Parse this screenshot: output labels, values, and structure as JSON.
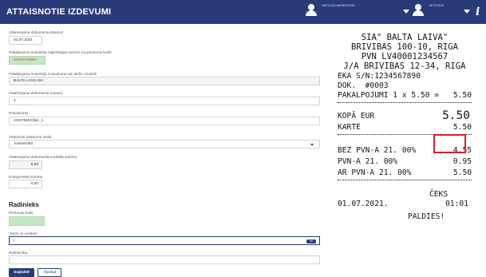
{
  "header": {
    "title": "ATTAISNOTIE IZDEVUMI",
    "user1": "NIKOLAJS NAKRASTIŅŠ",
    "user2": "LIETOTĀJS",
    "info_glyph": "i"
  },
  "form": {
    "doc_date_label": "Attaisnojuma dokumenta datums*",
    "doc_date_value": "01.07.2021",
    "seller_reg_label": "Pakalpojuma sniedzēja reģistrācijas numurs vai personas kods*",
    "seller_reg_value": "40001234567",
    "seller_name_label": "Pakalpojuma sniedzēja nosaukums vai vārds, uzvārds",
    "seller_name_value": "BALTA LAIVA SIA",
    "doc_number_label": "Attaisnojuma dokumenta numurs",
    "doc_number_value": "3",
    "name_label": "Nosaukums",
    "name_value": "ĀRSTNIECĪBA_1",
    "expense_type_label": "Attaisnoto izdevumu veids",
    "expense_type_value": "Ārstniecība",
    "amount_label": "Attaisnojuma dokumentā norādītā summa",
    "amount_value": "5,50",
    "compensated_label": "Kompensētā summa",
    "compensated_value": "0,00",
    "relatives_title": "Radinieks",
    "personal_code_label": "Personas kods",
    "personal_code_value": "",
    "full_name_label": "Vārds un uzvārds",
    "full_name_value": "|",
    "full_name_badge": "OK",
    "kinship_label": "Radniecība",
    "kinship_value": "",
    "save_label": "Saglabāt",
    "cancel_label": "Atpakaļ"
  },
  "receipt": {
    "company": "SIA\" BALTA LAIVA\"",
    "address": "BRIVIBAS 100-10, RIGA",
    "vat": "PVN LV40001234567",
    "legal_address": "J/A BRIVIBAS 12-34, RIGA",
    "eka": "EKA S/N:1234567890",
    "doc": "DOK.  #0003",
    "service_line": "PAKALPOJUMI 1 x 5.50 =",
    "service_amount": "5.50",
    "total_label": "KOPĀ EUR",
    "total_amount": "5.50",
    "card_label": "KARTE",
    "card_amount": "5.50",
    "vat_excl_label": "BEZ PVN-A 21. 00%",
    "vat_excl_amount": "4.55",
    "vat_label": "PVN-A 21. 00%",
    "vat_amount": "0.95",
    "vat_incl_label": "AR PVN-A 21. 00%",
    "vat_incl_amount": "5.50",
    "receipt_word": "ČEKS",
    "date": "01.07.2021.",
    "time": "01:01",
    "thanks": "PALDIES!"
  },
  "colors": {
    "header_bg": "#283a78",
    "highlight": "#d81f25",
    "field_green": "#c3e8c5"
  }
}
